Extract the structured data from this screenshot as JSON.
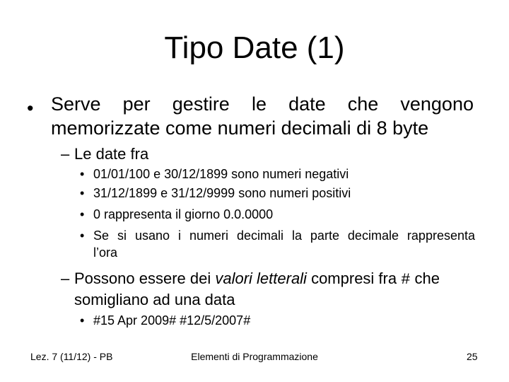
{
  "slide": {
    "title": "Tipo Date (1)",
    "bullet_glyph": "•",
    "dash_glyph": "–",
    "level1": {
      "line1": "Serve per gestire le date che vengono",
      "line2": "memorizzate come numeri decimali di 8 byte"
    },
    "level2_a": {
      "text": "Le date fra"
    },
    "level3_a": [
      {
        "text": "01/01/100 e 30/12/1899 sono numeri negativi"
      },
      {
        "text": "31/12/1899 e 31/12/9999 sono numeri positivi"
      },
      {
        "text": "0 rappresenta il giorno 0.0.0000"
      },
      {
        "text": "Se si usano i numeri decimali la parte decimale rappresenta",
        "continuation": "l’ora"
      }
    ],
    "level2_b": {
      "part1": "Possono essere dei ",
      "italic": "valori letterali",
      "part2": " compresi fra ",
      "symbol": "#",
      "part3": " che",
      "line2": "somigliano ad una data"
    },
    "level3_b": [
      {
        "text": "#15 Apr 2009# #12/5/2007#"
      }
    ]
  },
  "footer": {
    "left": "Lez. 7 (11/12) - PB",
    "center": "Elementi di Programmazione",
    "page_number": "25"
  }
}
